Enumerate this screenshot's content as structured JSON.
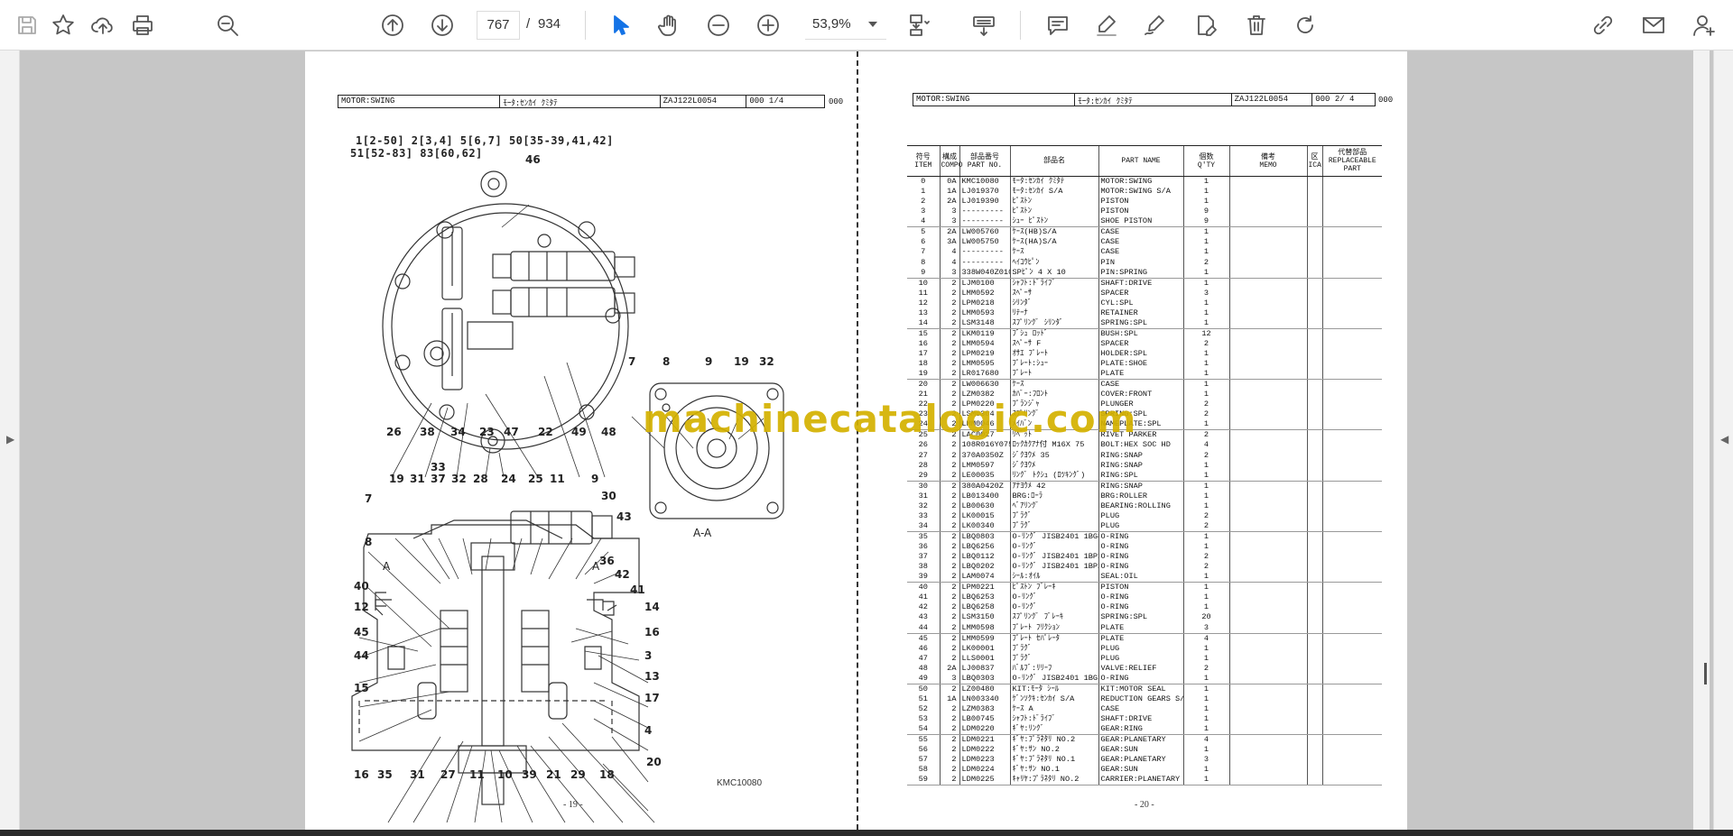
{
  "toolbar": {
    "current_page": "767",
    "page_separator": "/",
    "total_pages": "934",
    "zoom": "53,9%"
  },
  "colors": {
    "accent": "#1473e6",
    "watermark": "#d4b100"
  },
  "page_left": {
    "header": {
      "col1": "MOTOR:SWING",
      "col2": "ﾓｰﾀ:ｾﾝｶｲ ｸﾐﾀﾃ",
      "col3": "ZAJ122L0054",
      "col4": "000  1/4",
      "outside": "000"
    },
    "groups_line1": "1[2-50] 2[3,4] 5[6,7] 50[35-39,41,42]",
    "groups_line2": "51[52-83] 83[60,62]",
    "section_label": "A-A",
    "section_mark_left": "A",
    "section_mark_right": "A",
    "drawing_code": "KMC10080",
    "page_number": "- 19 -",
    "callouts_top": [
      "46",
      "26",
      "38",
      "34",
      "23",
      "47",
      "22",
      "49",
      "48"
    ],
    "callouts_section": [
      "7",
      "8",
      "9",
      "19",
      "32"
    ],
    "callouts_cross_top": [
      "33",
      "19",
      "31",
      "37",
      "32",
      "28",
      "24",
      "25",
      "11",
      "9",
      "30",
      "43"
    ],
    "callouts_cross_left": [
      "7",
      "8",
      "40",
      "12",
      "45",
      "44",
      "15"
    ],
    "callouts_cross_right": [
      "36",
      "42",
      "41",
      "14",
      "16",
      "3",
      "13",
      "17",
      "4",
      "20"
    ],
    "callouts_cross_bottom": [
      "16",
      "35",
      "31",
      "27",
      "11",
      "10",
      "39",
      "21",
      "29",
      "18"
    ]
  },
  "page_right": {
    "header": {
      "col1": "MOTOR:SWING",
      "col2": "ﾓｰﾀ:ｾﾝｶｲ ｸﾐﾀﾃ",
      "col3": "ZAJ122L0054",
      "col4": "000  2/ 4",
      "outside": "000"
    },
    "columns": [
      {
        "jp": "符号",
        "en": "ITEM"
      },
      {
        "jp": "構成",
        "en": "COMPO"
      },
      {
        "jp": "部品番号",
        "en": "PART NO."
      },
      {
        "jp": "部品名",
        "en": ""
      },
      {
        "jp": "",
        "en": "PART  NAME"
      },
      {
        "jp": "個数",
        "en": "Q'TY"
      },
      {
        "jp": "備考",
        "en": "MEMO"
      },
      {
        "jp": "区",
        "en": "ICA"
      },
      {
        "jp": "代替部品",
        "en": "REPLACEABLE PART"
      }
    ],
    "groups": [
      [
        [
          "0",
          "0A",
          "KMC10080",
          "ﾓｰﾀ:ｾﾝｶｲ ｸﾐﾀﾃ",
          "MOTOR:SWING",
          "1"
        ],
        [
          "1",
          "1A",
          "LJ019370",
          "ﾓｰﾀ:ｾﾝｶｲ S/A",
          "MOTOR:SWING S/A",
          "1"
        ],
        [
          "2",
          "2A",
          "LJ019390",
          "ﾋﾟｽﾄﾝ",
          "PISTON",
          "1"
        ],
        [
          "3",
          "3",
          "---------",
          "ﾋﾟｽﾄﾝ",
          "PISTON",
          "9"
        ],
        [
          "4",
          "3",
          "---------",
          "ｼｭｰ ﾋﾟｽﾄﾝ",
          "SHOE PISTON",
          "9"
        ]
      ],
      [
        [
          "5",
          "2A",
          "LW005760",
          "ｹｰｽ(HB)S/A",
          "CASE",
          "1"
        ],
        [
          "6",
          "3A",
          "LW005750",
          "ｹｰｽ(HA)S/A",
          "CASE",
          "1"
        ],
        [
          "7",
          "4",
          "---------",
          "ｹｰｽ",
          "CASE",
          "1"
        ],
        [
          "8",
          "4",
          "---------",
          "ﾍｲｺｳﾋﾟﾝ",
          "PIN",
          "2"
        ],
        [
          "9",
          "3",
          "338W040Z010B",
          "SPﾋﾟﾝ  4  X 10",
          "PIN:SPRING",
          "1"
        ]
      ],
      [
        [
          "10",
          "2",
          "LJM0100",
          "ｼｬﾌﾄ:ﾄﾞﾗｲﾌﾞ",
          "SHAFT:DRIVE",
          "1"
        ],
        [
          "11",
          "2",
          "LMM0592",
          "ｽﾍﾟｰｻ",
          "SPACER",
          "3"
        ],
        [
          "12",
          "2",
          "LPM0218",
          "ｼﾘﾝﾀﾞ",
          "CYL:SPL",
          "1"
        ],
        [
          "13",
          "2",
          "LMM0593",
          "ﾘﾃｰﾅ",
          "RETAINER",
          "1"
        ],
        [
          "14",
          "2",
          "LSM3148",
          "ｽﾌﾟﾘﾝｸﾞ ｼﾘﾝﾀﾞ",
          "SPRING:SPL",
          "1"
        ]
      ],
      [
        [
          "15",
          "2",
          "LKM0119",
          "ﾌﾞｼｭ ﾛｯﾄﾞ",
          "BUSH:SPL",
          "12"
        ],
        [
          "16",
          "2",
          "LMM0594",
          "ｽﾍﾟｰｻ F",
          "SPACER",
          "2"
        ],
        [
          "17",
          "2",
          "LPM0219",
          "ｵｻｴ ﾌﾟﾚｰﾄ",
          "HOLDER:SPL",
          "1"
        ],
        [
          "18",
          "2",
          "LMM0595",
          "ﾌﾟﾚｰﾄ:ｼｭｰ",
          "PLATE:SHOE",
          "1"
        ],
        [
          "19",
          "2",
          "LR017680",
          "ﾌﾟﾚｰﾄ",
          "PLATE",
          "1"
        ]
      ],
      [
        [
          "20",
          "2",
          "LW006630",
          "ｹｰｽ",
          "CASE",
          "1"
        ],
        [
          "21",
          "2",
          "LZM0382",
          "ｶﾊﾞｰ:ﾌﾛﾝﾄ",
          "COVER:FRONT",
          "1"
        ],
        [
          "22",
          "2",
          "LPM0220",
          "ﾌﾟﾗﾝｼﾞｬ",
          "PLUNGER",
          "2"
        ],
        [
          "23",
          "2",
          "LSM0304",
          "ｽﾌﾟﾘﾝｸﾞ",
          "SPRING:SPL",
          "2"
        ],
        [
          "24",
          "2",
          "LMM0046",
          "ﾒｲﾊﾞﾝ",
          "NAMEPLATE:SPL",
          "1"
        ]
      ],
      [
        [
          "25",
          "2",
          "LAC0027",
          "ﾘﾍﾞｯﾄ",
          "RIVET PARKER",
          "2"
        ],
        [
          "26",
          "2",
          "108R016Y075N",
          "ﾛｯｸｶｸｱﾅ付 M16X 75",
          "BOLT:HEX SOC HD",
          "4"
        ],
        [
          "27",
          "2",
          "370A0350Z",
          "ｼﾞｸﾖｳﾒ  35",
          "RING:SNAP",
          "2"
        ],
        [
          "28",
          "2",
          "LMM0597",
          "ｼﾞｸﾖｳﾒ",
          "RING:SNAP",
          "1"
        ],
        [
          "29",
          "2",
          "LE00035",
          "ﾘﾝｸﾞ ﾄｸｼｭ (ﾛﾂｷﾝｸﾞ)",
          "RING:SPL",
          "1"
        ]
      ],
      [
        [
          "30",
          "2",
          "380A0420Z",
          "ｱﾅﾖｳﾒ  42",
          "RING:SNAP",
          "1"
        ],
        [
          "31",
          "2",
          "LB013400",
          "BRG:ﾛｰﾗ",
          "BRG:ROLLER",
          "1"
        ],
        [
          "32",
          "2",
          "LB00630",
          "ﾍﾞｱﾘﾝｸﾞ",
          "BEARING:ROLLING",
          "1"
        ],
        [
          "33",
          "2",
          "LK00015",
          "ﾌﾟﾗｸﾞ",
          "PLUG",
          "2"
        ],
        [
          "34",
          "2",
          "LK00340",
          "ﾌﾟﾗｸﾞ",
          "PLUG",
          "2"
        ]
      ],
      [
        [
          "35",
          "2",
          "LBQ0803",
          "O-ﾘﾝｸﾞ  JISB2401 1BG8",
          "O-RING",
          "1"
        ],
        [
          "36",
          "2",
          "LBQ6256",
          "O-ﾘﾝｸﾞ",
          "O-RING",
          "1"
        ],
        [
          "37",
          "2",
          "LBQ0112",
          "O-ﾘﾝｸﾞ  JISB2401 1BP1",
          "O-RING",
          "2"
        ],
        [
          "38",
          "2",
          "LBQ0202",
          "O-ﾘﾝｸﾞ  JISB2401 1BP2",
          "O-RING",
          "2"
        ],
        [
          "39",
          "2",
          "LAM0074",
          "ｼｰﾙ:ｵｲﾙ",
          "SEAL:OIL",
          "1"
        ]
      ],
      [
        [
          "40",
          "2",
          "LPM0221",
          "ﾋﾟｽﾄﾝ ﾌﾞﾚｰｷ",
          "PISTON",
          "1"
        ],
        [
          "41",
          "2",
          "LBQ6253",
          "O-ﾘﾝｸﾞ",
          "O-RING",
          "1"
        ],
        [
          "42",
          "2",
          "LBQ6258",
          "O-ﾘﾝｸﾞ",
          "O-RING",
          "1"
        ],
        [
          "43",
          "2",
          "LSM3150",
          "ｽﾌﾟﾘﾝｸﾞ ﾌﾞﾚｰｷ",
          "SPRING:SPL",
          "20"
        ],
        [
          "44",
          "2",
          "LMM0598",
          "ﾌﾟﾚｰﾄ ﾌﾘｸｼｮﾝ",
          "PLATE",
          "3"
        ]
      ],
      [
        [
          "45",
          "2",
          "LMM0599",
          "ﾌﾟﾚｰﾄ ｾﾊﾟﾚｰﾀ",
          "PLATE",
          "4"
        ],
        [
          "46",
          "2",
          "LK00001",
          "ﾌﾟﾗｸﾞ",
          "PLUG",
          "1"
        ],
        [
          "47",
          "2",
          "LLS0001",
          "ﾌﾟﾗｸﾞ",
          "PLUG",
          "1"
        ],
        [
          "48",
          "2A",
          "LJ00837",
          "ﾊﾞﾙﾌﾞ:ﾘﾘｰﾌ",
          "VALVE:RELIEF",
          "2"
        ],
        [
          "49",
          "3",
          "LBQ0303",
          "O-ﾘﾝｸﾞ  JISB2401 1BG3",
          "O-RING",
          "1"
        ]
      ],
      [
        [
          "50",
          "2",
          "LZ00480",
          "KIT:ﾓｰﾀ ｼｰﾙ",
          "KIT:MOTOR SEAL",
          "1"
        ],
        [
          "51",
          "1A",
          "LN003340",
          "ｹﾞﾝｿｸｷ:ｾﾝｶｲ S/A",
          "REDUCTION GEARS S/A",
          "1"
        ],
        [
          "52",
          "2",
          "LZM0383",
          "ｹｰｽ A",
          "CASE",
          "1"
        ],
        [
          "53",
          "2",
          "LB00745",
          "ｼｬﾌﾄ:ﾄﾞﾗｲﾌﾞ",
          "SHAFT:DRIVE",
          "1"
        ],
        [
          "54",
          "2",
          "LDM0220",
          "ｷﾞﾔ:ﾘﾝｸﾞ",
          "GEAR:RING",
          "1"
        ]
      ],
      [
        [
          "55",
          "2",
          "LDM0221",
          "ｷﾞﾔ:ﾌﾟﾗﾈﾀﾘ NO.2",
          "GEAR:PLANETARY",
          "4"
        ],
        [
          "56",
          "2",
          "LDM0222",
          "ｷﾞﾔ:ｻﾝ NO.2",
          "GEAR:SUN",
          "1"
        ],
        [
          "57",
          "2",
          "LDM0223",
          "ｷﾞﾔ:ﾌﾟﾗﾈﾀﾘ NO.1",
          "GEAR:PLANETARY",
          "3"
        ],
        [
          "58",
          "2",
          "LDM0224",
          "ｷﾞﾔ:ｻﾝ NO.1",
          "GEAR:SUN",
          "1"
        ],
        [
          "59",
          "2",
          "LDM0225",
          "ｷｬﾘﾔ:ﾌﾟﾗﾈﾀﾘ NO.2",
          "CARRIER:PLANETARY",
          "1"
        ]
      ]
    ],
    "page_number": "- 20 -"
  },
  "watermark": "machinecatalogic.com"
}
